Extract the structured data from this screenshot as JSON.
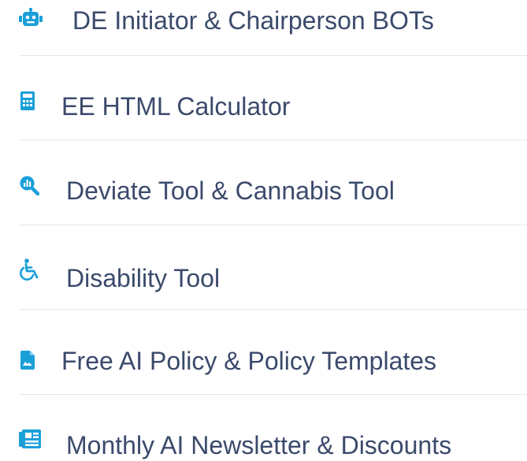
{
  "accent_color": "#1a9fd9",
  "text_color": "#3b4a6b",
  "menu": {
    "items": [
      {
        "label": "DE Initiator & Chairperson BOTs",
        "icon": "robot-icon"
      },
      {
        "label": "EE HTML Calculator",
        "icon": "calculator-icon"
      },
      {
        "label": "Deviate Tool & Cannabis Tool",
        "icon": "chart-search-icon"
      },
      {
        "label": "Disability Tool",
        "icon": "wheelchair-icon"
      },
      {
        "label": "Free AI Policy & Policy Templates",
        "icon": "document-icon"
      },
      {
        "label": "Monthly AI Newsletter & Discounts",
        "icon": "newspaper-icon"
      }
    ]
  }
}
